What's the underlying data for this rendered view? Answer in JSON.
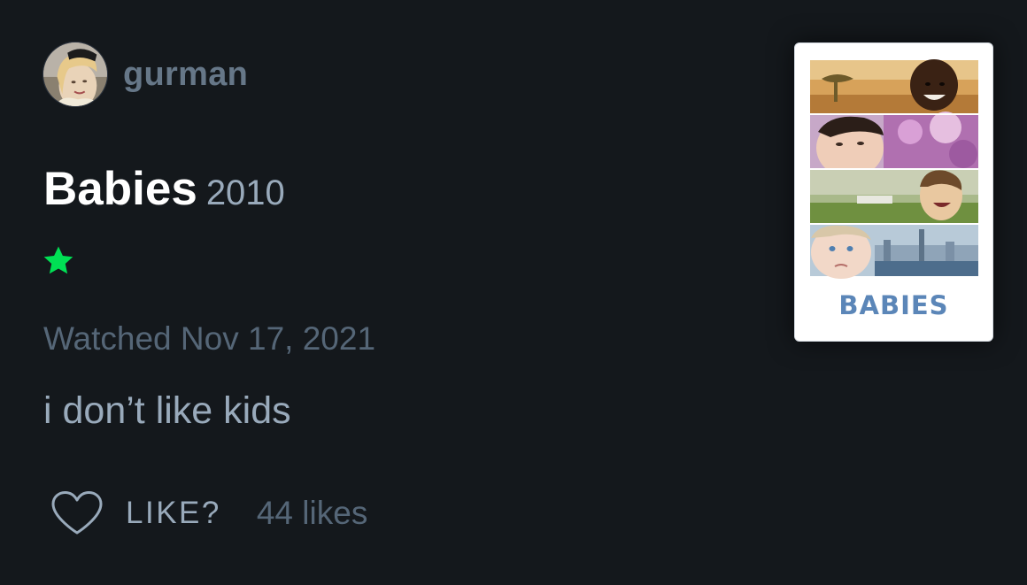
{
  "review": {
    "author": {
      "username": "gurman",
      "avatar_icon": "user-avatar-photo"
    },
    "film": {
      "title": "Babies",
      "year": "2010",
      "poster_title": "BABIES"
    },
    "rating": {
      "stars": 1,
      "max_stars": 5,
      "star_icon": "star-icon",
      "color": "#00e054"
    },
    "watched_label": "Watched Nov 17, 2021",
    "text": "i don’t like kids",
    "like": {
      "icon": "heart-outline-icon",
      "label": "LIKE?",
      "count_text": "44 likes"
    }
  },
  "colors": {
    "background": "#14181c",
    "username": "#667788",
    "secondary_text": "#99aabb",
    "muted_text": "#556677",
    "accent_green": "#00e054",
    "poster_title": "#5b86b8"
  }
}
